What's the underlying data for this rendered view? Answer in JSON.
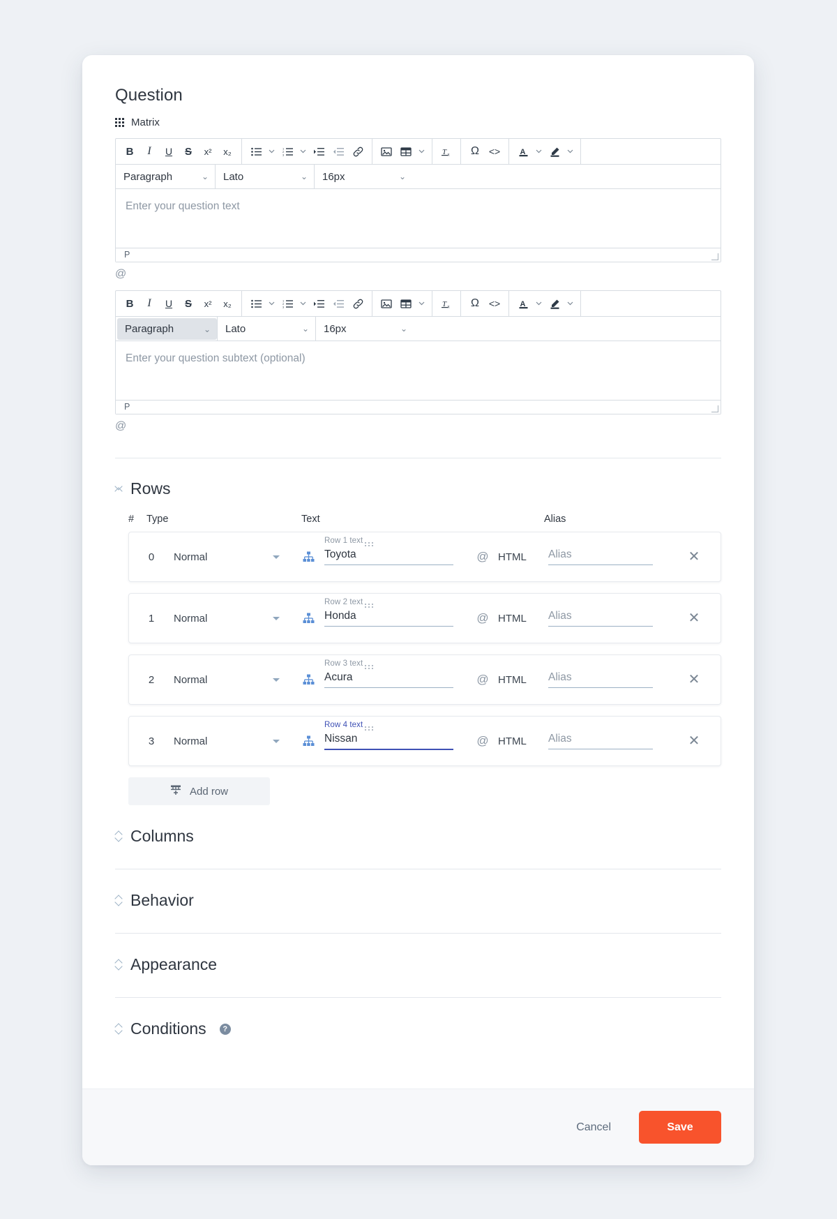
{
  "question": {
    "heading": "Question",
    "type_label": "Matrix",
    "type_icon": "matrix-grid-icon"
  },
  "toolbar": {
    "bold": "B",
    "italic": "I",
    "underline": "U",
    "strikethrough": "S",
    "superscript": "x²",
    "subscript": "x₂",
    "bullet_list": "bullet-list-icon",
    "numbered_list": "numbered-list-icon",
    "indent": "indent-icon",
    "outdent": "outdent-icon",
    "link": "link-icon",
    "image": "image-icon",
    "table": "table-icon",
    "clear_format": "clear-formatting-icon",
    "special_char": "Ω",
    "source_code": "<>",
    "font_color": "A",
    "highlight": "highlighter-icon"
  },
  "editor_main": {
    "style_value": "Paragraph",
    "font_value": "Lato",
    "size_value": "16px",
    "placeholder": "Enter your question text",
    "status": "P",
    "mention": "@"
  },
  "editor_sub": {
    "style_value": "Paragraph",
    "font_value": "Lato",
    "size_value": "16px",
    "placeholder": "Enter your question subtext (optional)",
    "status": "P",
    "mention": "@"
  },
  "rows_section": {
    "title": "Rows",
    "columns": {
      "num": "#",
      "type": "Type",
      "text": "Text",
      "alias": "Alias"
    },
    "add_row_label": "Add row",
    "items": [
      {
        "num": "0",
        "type": "Normal",
        "text_label": "Row 1 text",
        "text_value": "Toyota",
        "alias_placeholder": "Alias",
        "alias_value": "",
        "html_label": "HTML",
        "mention": "@",
        "focused": false
      },
      {
        "num": "1",
        "type": "Normal",
        "text_label": "Row 2 text",
        "text_value": "Honda",
        "alias_placeholder": "Alias",
        "alias_value": "",
        "html_label": "HTML",
        "mention": "@",
        "focused": false
      },
      {
        "num": "2",
        "type": "Normal",
        "text_label": "Row 3 text",
        "text_value": "Acura",
        "alias_placeholder": "Alias",
        "alias_value": "",
        "html_label": "HTML",
        "mention": "@",
        "focused": false
      },
      {
        "num": "3",
        "type": "Normal",
        "text_label": "Row 4 text",
        "text_value": "Nissan",
        "alias_placeholder": "Alias",
        "alias_value": "",
        "html_label": "HTML",
        "mention": "@",
        "focused": true
      }
    ]
  },
  "collapsed_sections": [
    {
      "title": "Columns",
      "has_help": false
    },
    {
      "title": "Behavior",
      "has_help": false
    },
    {
      "title": "Appearance",
      "has_help": false
    },
    {
      "title": "Conditions",
      "has_help": true,
      "help_glyph": "?"
    }
  ],
  "footer": {
    "cancel_label": "Cancel",
    "save_label": "Save"
  },
  "colors": {
    "save_button": "#f8532c",
    "page_background": "#eef1f5",
    "focus_blue": "#3f51b5",
    "tree_icon_blue": "#5b8fd6"
  }
}
